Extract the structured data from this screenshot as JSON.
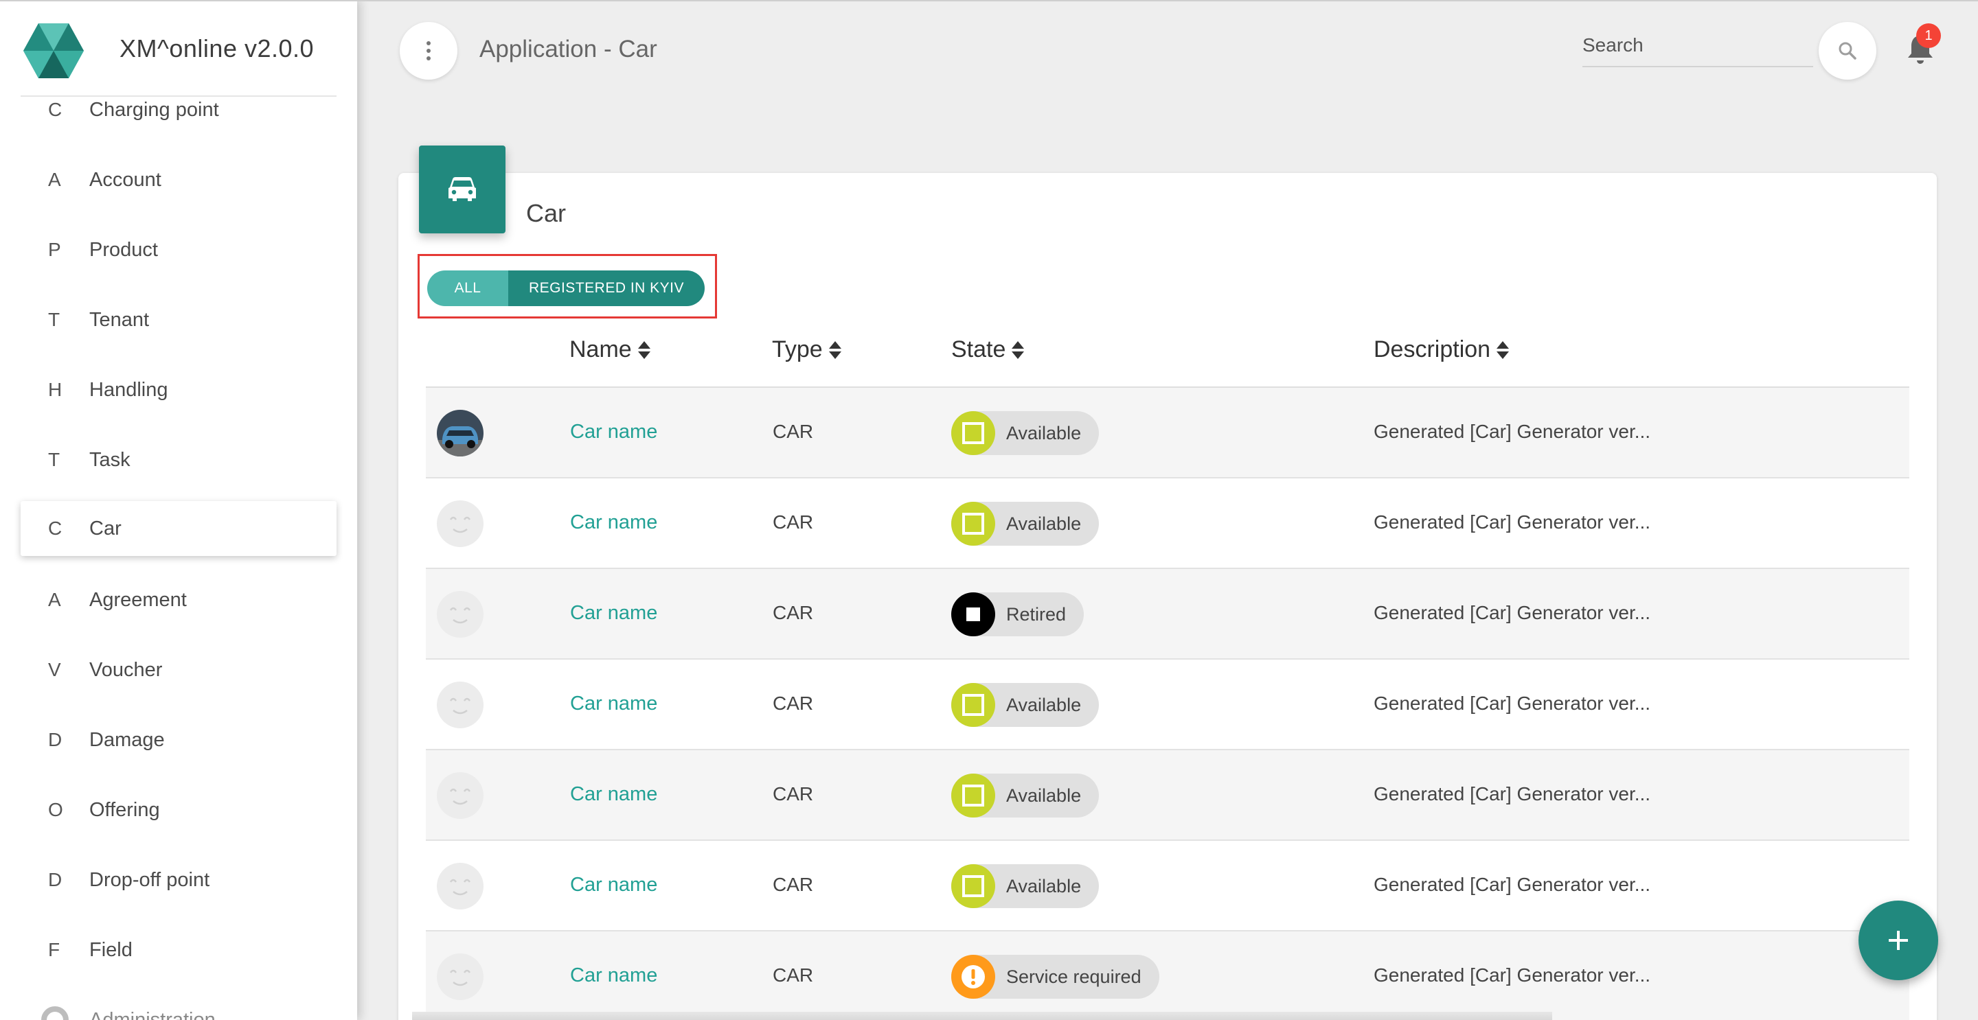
{
  "app": {
    "title": "XM^online v2.0.0"
  },
  "header": {
    "page_title": "Application - Car",
    "search_placeholder": "Search",
    "notification_count": "1"
  },
  "sidebar": {
    "items": [
      {
        "letter": "C",
        "label": "Charging point"
      },
      {
        "letter": "A",
        "label": "Account"
      },
      {
        "letter": "P",
        "label": "Product"
      },
      {
        "letter": "T",
        "label": "Tenant"
      },
      {
        "letter": "H",
        "label": "Handling"
      },
      {
        "letter": "T",
        "label": "Task"
      },
      {
        "letter": "C",
        "label": "Car",
        "active": true
      },
      {
        "letter": "A",
        "label": "Agreement"
      },
      {
        "letter": "V",
        "label": "Voucher"
      },
      {
        "letter": "D",
        "label": "Damage"
      },
      {
        "letter": "O",
        "label": "Offering"
      },
      {
        "letter": "D",
        "label": "Drop-off point"
      },
      {
        "letter": "F",
        "label": "Field"
      },
      {
        "letter": "",
        "label": "Administration",
        "icon": "gear-icon"
      }
    ]
  },
  "card": {
    "title": "Car",
    "icon": "car-icon",
    "filters": {
      "all": "ALL",
      "registered": "REGISTERED IN KYIV"
    },
    "columns": {
      "name": "Name",
      "type": "Type",
      "state": "State",
      "description": "Description"
    },
    "rows": [
      {
        "name": "Car name",
        "type": "CAR",
        "state": "Available",
        "state_color": "#c6d52b",
        "state_icon": "square",
        "description": "Generated [Car] Generator ver...",
        "avatar": "photo"
      },
      {
        "name": "Car name",
        "type": "CAR",
        "state": "Available",
        "state_color": "#c6d52b",
        "state_icon": "square",
        "description": "Generated [Car] Generator ver...",
        "avatar": "placeholder"
      },
      {
        "name": "Car name",
        "type": "CAR",
        "state": "Retired",
        "state_color": "#000000",
        "state_icon": "stop",
        "description": "Generated [Car] Generator ver...",
        "avatar": "placeholder"
      },
      {
        "name": "Car name",
        "type": "CAR",
        "state": "Available",
        "state_color": "#c6d52b",
        "state_icon": "square",
        "description": "Generated [Car] Generator ver...",
        "avatar": "placeholder"
      },
      {
        "name": "Car name",
        "type": "CAR",
        "state": "Available",
        "state_color": "#c6d52b",
        "state_icon": "square",
        "description": "Generated [Car] Generator ver...",
        "avatar": "placeholder"
      },
      {
        "name": "Car name",
        "type": "CAR",
        "state": "Available",
        "state_color": "#c6d52b",
        "state_icon": "square",
        "description": "Generated [Car] Generator ver...",
        "avatar": "placeholder"
      },
      {
        "name": "Car name",
        "type": "CAR",
        "state": "Service required",
        "state_color": "#ff9a1a",
        "state_icon": "alert",
        "description": "Generated [Car] Generator ver...",
        "avatar": "placeholder"
      }
    ]
  },
  "colors": {
    "primary": "#21897e",
    "primary_light": "#4db6ac",
    "link": "#21a094",
    "highlight_box": "#e53935",
    "badge": "#f44336"
  }
}
